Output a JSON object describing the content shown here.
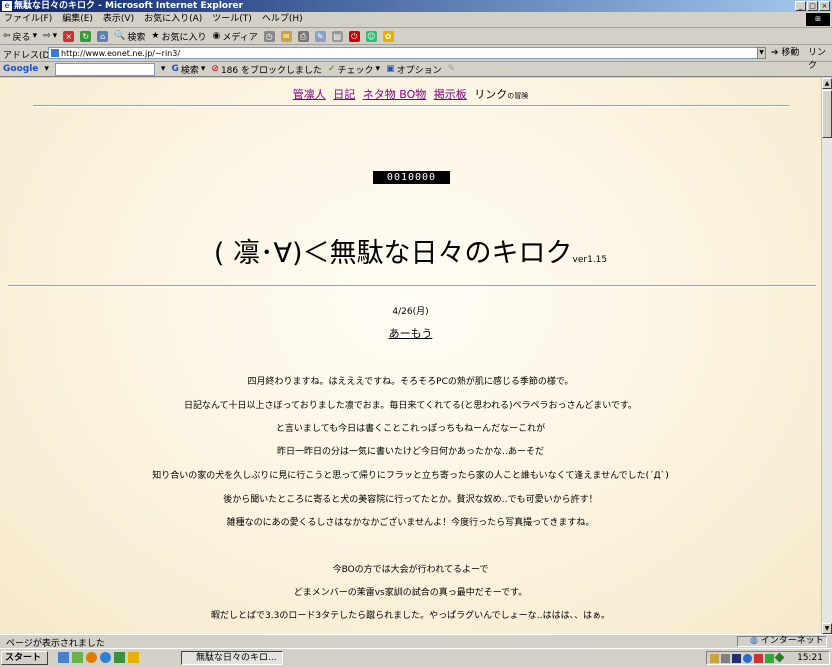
{
  "window": {
    "title": "無駄な日々のキロク - Microsoft Internet Explorer",
    "minimize": "_",
    "maximize": "□",
    "close": "×"
  },
  "menu": [
    "ファイル(F)",
    "編集(E)",
    "表示(V)",
    "お気に入り(A)",
    "ツール(T)",
    "ヘルプ(H)"
  ],
  "toolbar": {
    "back": "戻る",
    "search": "検索",
    "favorites": "お気に入り",
    "media": "メディア"
  },
  "address": {
    "label": "アドレス(D)",
    "url": "http://www.eonet.ne.jp/~rin3/",
    "go": "移動",
    "links": "リンク"
  },
  "googlebar": {
    "logo": "Google",
    "search": "検索",
    "blocked": "186 をブロックしました",
    "check": "チェック",
    "options": "オプション"
  },
  "page": {
    "nav": {
      "link1": "管凛人",
      "link2": "日記",
      "link3": "ネタ物 BO物",
      "link4": "掲示板",
      "link5": "リンク",
      "link5_small": "の冒険"
    },
    "counter": "0010000",
    "title": "( 凛･∀)＜無駄な日々のキロク",
    "version": "ver1.15",
    "date": "4/26(月)",
    "entry_title": "あーもう",
    "paragraphs": [
      "四月終わりますね。はえええですね。そろそろPCの熱が肌に感じる季節の様で。",
      "日記なんて十日以上さぼっておりました凛でおま。毎日来てくれてる(と思われる)ペラペラおっさんどまいです。",
      "と言いましても今日は書くことこれっぽっちもねーんだなーこれが",
      "昨日一昨日の分は一気に書いたけど今日何かあったかな‥あーそだ",
      "知り合いの家の犬を久しぶりに見に行こうと思って帰りにフラッと立ち寄ったら家の人こと誰もいなくて逢えませんでした(´Д`)",
      "後から聞いたところに寄ると犬の美容院に行ってたとか。贅沢な奴め‥でも可愛いから許す！",
      "雑種なのにあの愛くるしさはなかなかございませんよ！今度行ったら写真撮ってきますね。",
      "今BOの方では大会が行われてるよーで",
      "どまメンバーの茉雷vs家訓の試合の真っ最中だそーです。",
      "暇だしとばで3.3のロード3タテしたら蹴られました。やっぱラグいんでしょーな‥ははは、、はぁ。"
    ]
  },
  "status": {
    "text": "ページが表示されました",
    "zone": "インターネット"
  },
  "taskbar": {
    "start": "スタート",
    "task": "無駄な日々のキロ...",
    "clock": "15:21"
  }
}
